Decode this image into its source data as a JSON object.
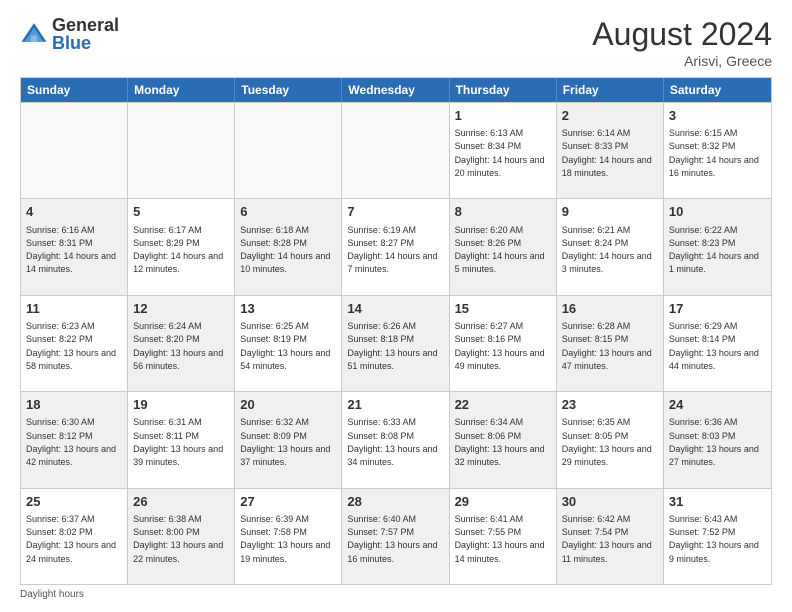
{
  "header": {
    "logo_general": "General",
    "logo_blue": "Blue",
    "month_year": "August 2024",
    "location": "Arisvi, Greece"
  },
  "days_of_week": [
    "Sunday",
    "Monday",
    "Tuesday",
    "Wednesday",
    "Thursday",
    "Friday",
    "Saturday"
  ],
  "weeks": [
    [
      {
        "day": "",
        "empty": true,
        "shaded": false,
        "sunrise": "",
        "sunset": "",
        "daylight": ""
      },
      {
        "day": "",
        "empty": true,
        "shaded": false,
        "sunrise": "",
        "sunset": "",
        "daylight": ""
      },
      {
        "day": "",
        "empty": true,
        "shaded": false,
        "sunrise": "",
        "sunset": "",
        "daylight": ""
      },
      {
        "day": "",
        "empty": true,
        "shaded": false,
        "sunrise": "",
        "sunset": "",
        "daylight": ""
      },
      {
        "day": "1",
        "empty": false,
        "shaded": false,
        "sunrise": "6:13 AM",
        "sunset": "8:34 PM",
        "daylight": "14 hours and 20 minutes."
      },
      {
        "day": "2",
        "empty": false,
        "shaded": true,
        "sunrise": "6:14 AM",
        "sunset": "8:33 PM",
        "daylight": "14 hours and 18 minutes."
      },
      {
        "day": "3",
        "empty": false,
        "shaded": false,
        "sunrise": "6:15 AM",
        "sunset": "8:32 PM",
        "daylight": "14 hours and 16 minutes."
      }
    ],
    [
      {
        "day": "4",
        "empty": false,
        "shaded": true,
        "sunrise": "6:16 AM",
        "sunset": "8:31 PM",
        "daylight": "14 hours and 14 minutes."
      },
      {
        "day": "5",
        "empty": false,
        "shaded": false,
        "sunrise": "6:17 AM",
        "sunset": "8:29 PM",
        "daylight": "14 hours and 12 minutes."
      },
      {
        "day": "6",
        "empty": false,
        "shaded": true,
        "sunrise": "6:18 AM",
        "sunset": "8:28 PM",
        "daylight": "14 hours and 10 minutes."
      },
      {
        "day": "7",
        "empty": false,
        "shaded": false,
        "sunrise": "6:19 AM",
        "sunset": "8:27 PM",
        "daylight": "14 hours and 7 minutes."
      },
      {
        "day": "8",
        "empty": false,
        "shaded": true,
        "sunrise": "6:20 AM",
        "sunset": "8:26 PM",
        "daylight": "14 hours and 5 minutes."
      },
      {
        "day": "9",
        "empty": false,
        "shaded": false,
        "sunrise": "6:21 AM",
        "sunset": "8:24 PM",
        "daylight": "14 hours and 3 minutes."
      },
      {
        "day": "10",
        "empty": false,
        "shaded": true,
        "sunrise": "6:22 AM",
        "sunset": "8:23 PM",
        "daylight": "14 hours and 1 minute."
      }
    ],
    [
      {
        "day": "11",
        "empty": false,
        "shaded": false,
        "sunrise": "6:23 AM",
        "sunset": "8:22 PM",
        "daylight": "13 hours and 58 minutes."
      },
      {
        "day": "12",
        "empty": false,
        "shaded": true,
        "sunrise": "6:24 AM",
        "sunset": "8:20 PM",
        "daylight": "13 hours and 56 minutes."
      },
      {
        "day": "13",
        "empty": false,
        "shaded": false,
        "sunrise": "6:25 AM",
        "sunset": "8:19 PM",
        "daylight": "13 hours and 54 minutes."
      },
      {
        "day": "14",
        "empty": false,
        "shaded": true,
        "sunrise": "6:26 AM",
        "sunset": "8:18 PM",
        "daylight": "13 hours and 51 minutes."
      },
      {
        "day": "15",
        "empty": false,
        "shaded": false,
        "sunrise": "6:27 AM",
        "sunset": "8:16 PM",
        "daylight": "13 hours and 49 minutes."
      },
      {
        "day": "16",
        "empty": false,
        "shaded": true,
        "sunrise": "6:28 AM",
        "sunset": "8:15 PM",
        "daylight": "13 hours and 47 minutes."
      },
      {
        "day": "17",
        "empty": false,
        "shaded": false,
        "sunrise": "6:29 AM",
        "sunset": "8:14 PM",
        "daylight": "13 hours and 44 minutes."
      }
    ],
    [
      {
        "day": "18",
        "empty": false,
        "shaded": true,
        "sunrise": "6:30 AM",
        "sunset": "8:12 PM",
        "daylight": "13 hours and 42 minutes."
      },
      {
        "day": "19",
        "empty": false,
        "shaded": false,
        "sunrise": "6:31 AM",
        "sunset": "8:11 PM",
        "daylight": "13 hours and 39 minutes."
      },
      {
        "day": "20",
        "empty": false,
        "shaded": true,
        "sunrise": "6:32 AM",
        "sunset": "8:09 PM",
        "daylight": "13 hours and 37 minutes."
      },
      {
        "day": "21",
        "empty": false,
        "shaded": false,
        "sunrise": "6:33 AM",
        "sunset": "8:08 PM",
        "daylight": "13 hours and 34 minutes."
      },
      {
        "day": "22",
        "empty": false,
        "shaded": true,
        "sunrise": "6:34 AM",
        "sunset": "8:06 PM",
        "daylight": "13 hours and 32 minutes."
      },
      {
        "day": "23",
        "empty": false,
        "shaded": false,
        "sunrise": "6:35 AM",
        "sunset": "8:05 PM",
        "daylight": "13 hours and 29 minutes."
      },
      {
        "day": "24",
        "empty": false,
        "shaded": true,
        "sunrise": "6:36 AM",
        "sunset": "8:03 PM",
        "daylight": "13 hours and 27 minutes."
      }
    ],
    [
      {
        "day": "25",
        "empty": false,
        "shaded": false,
        "sunrise": "6:37 AM",
        "sunset": "8:02 PM",
        "daylight": "13 hours and 24 minutes."
      },
      {
        "day": "26",
        "empty": false,
        "shaded": true,
        "sunrise": "6:38 AM",
        "sunset": "8:00 PM",
        "daylight": "13 hours and 22 minutes."
      },
      {
        "day": "27",
        "empty": false,
        "shaded": false,
        "sunrise": "6:39 AM",
        "sunset": "7:58 PM",
        "daylight": "13 hours and 19 minutes."
      },
      {
        "day": "28",
        "empty": false,
        "shaded": true,
        "sunrise": "6:40 AM",
        "sunset": "7:57 PM",
        "daylight": "13 hours and 16 minutes."
      },
      {
        "day": "29",
        "empty": false,
        "shaded": false,
        "sunrise": "6:41 AM",
        "sunset": "7:55 PM",
        "daylight": "13 hours and 14 minutes."
      },
      {
        "day": "30",
        "empty": false,
        "shaded": true,
        "sunrise": "6:42 AM",
        "sunset": "7:54 PM",
        "daylight": "13 hours and 11 minutes."
      },
      {
        "day": "31",
        "empty": false,
        "shaded": false,
        "sunrise": "6:43 AM",
        "sunset": "7:52 PM",
        "daylight": "13 hours and 9 minutes."
      }
    ]
  ],
  "footer": {
    "daylight_label": "Daylight hours"
  }
}
